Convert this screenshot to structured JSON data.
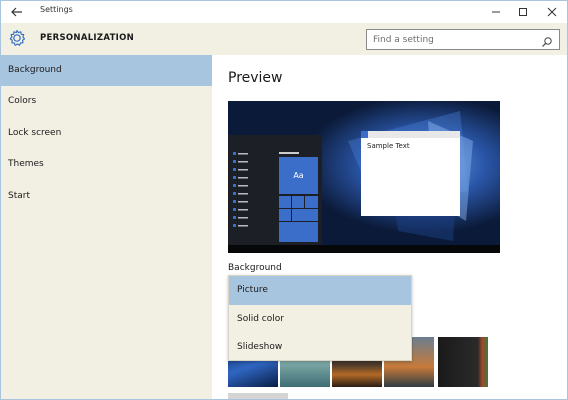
{
  "window": {
    "title": "Settings",
    "back_icon": "back-arrow-icon",
    "minimize_icon": "minimize-icon",
    "maximize_icon": "maximize-icon",
    "close_icon": "close-icon"
  },
  "header": {
    "icon": "gear-icon",
    "title": "PERSONALIZATION",
    "search": {
      "placeholder": "Find a setting",
      "value": "",
      "icon": "search-icon"
    }
  },
  "sidebar": {
    "items": [
      {
        "label": "Background",
        "selected": true
      },
      {
        "label": "Colors",
        "selected": false
      },
      {
        "label": "Lock screen",
        "selected": false
      },
      {
        "label": "Themes",
        "selected": false
      },
      {
        "label": "Start",
        "selected": false
      }
    ]
  },
  "main": {
    "preview_heading": "Preview",
    "preview": {
      "sample_text": "Sample Text",
      "tile_label": "Aa"
    },
    "background_label": "Background",
    "dropdown": {
      "options": [
        {
          "label": "Picture",
          "selected": true
        },
        {
          "label": "Solid color",
          "selected": false
        },
        {
          "label": "Slideshow",
          "selected": false
        }
      ]
    }
  },
  "colors": {
    "accent": "#3a6ec9",
    "selection": "#a8c5e0",
    "pane_background": "#f2efe3"
  }
}
